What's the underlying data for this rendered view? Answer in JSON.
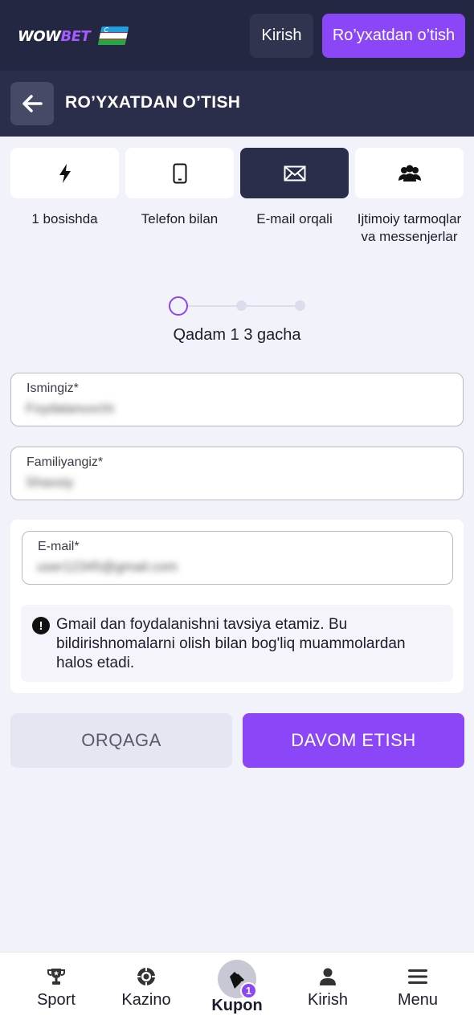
{
  "header": {
    "logo_wow": "WOW",
    "logo_bet": "BET",
    "login_label": "Kirish",
    "register_label": "Ro’yxatdan o’tish"
  },
  "title_bar": {
    "title": "RO’YXATDAN O’TISH"
  },
  "methods": [
    {
      "label": "1 bosishda",
      "icon": "lightning-icon",
      "active": false
    },
    {
      "label": "Telefon bilan",
      "icon": "phone-icon",
      "active": false
    },
    {
      "label": "E-mail orqali",
      "icon": "envelope-icon",
      "active": true
    },
    {
      "label": "Ijtimoiy tarmoqlar va messenjerlar",
      "icon": "users-icon",
      "active": false
    }
  ],
  "stepper": {
    "current_step": 1,
    "total_steps": 3,
    "text": "Qadam 1 3 gacha"
  },
  "form": {
    "first_name": {
      "label": "Ismingiz*",
      "value": "Foydalanuvchi"
    },
    "last_name": {
      "label": "Familiyangiz*",
      "value": "Shaxsiy"
    },
    "email": {
      "label": "E-mail*",
      "value": "user12345@gmail.com"
    },
    "notice": "Gmail dan foydalanishni tavsiya etamiz. Bu bildirishnomalarni olish bilan bog'liq muammolardan halos etadi."
  },
  "actions": {
    "back_label": "ORQAGA",
    "next_label": "DAVOM ETISH"
  },
  "bottom_nav": {
    "items": [
      {
        "label": "Sport",
        "icon": "trophy-icon"
      },
      {
        "label": "Kazino",
        "icon": "casino-chip-icon"
      },
      {
        "label": "Kupon",
        "icon": "ticket-icon",
        "badge": "1"
      },
      {
        "label": "Kirish",
        "icon": "user-icon"
      },
      {
        "label": "Menu",
        "icon": "hamburger-icon"
      }
    ]
  },
  "colors": {
    "accent": "#8a46f7",
    "header_bg": "#242741",
    "title_bg": "#2b2e4a",
    "page_bg": "#f2f2fb"
  }
}
